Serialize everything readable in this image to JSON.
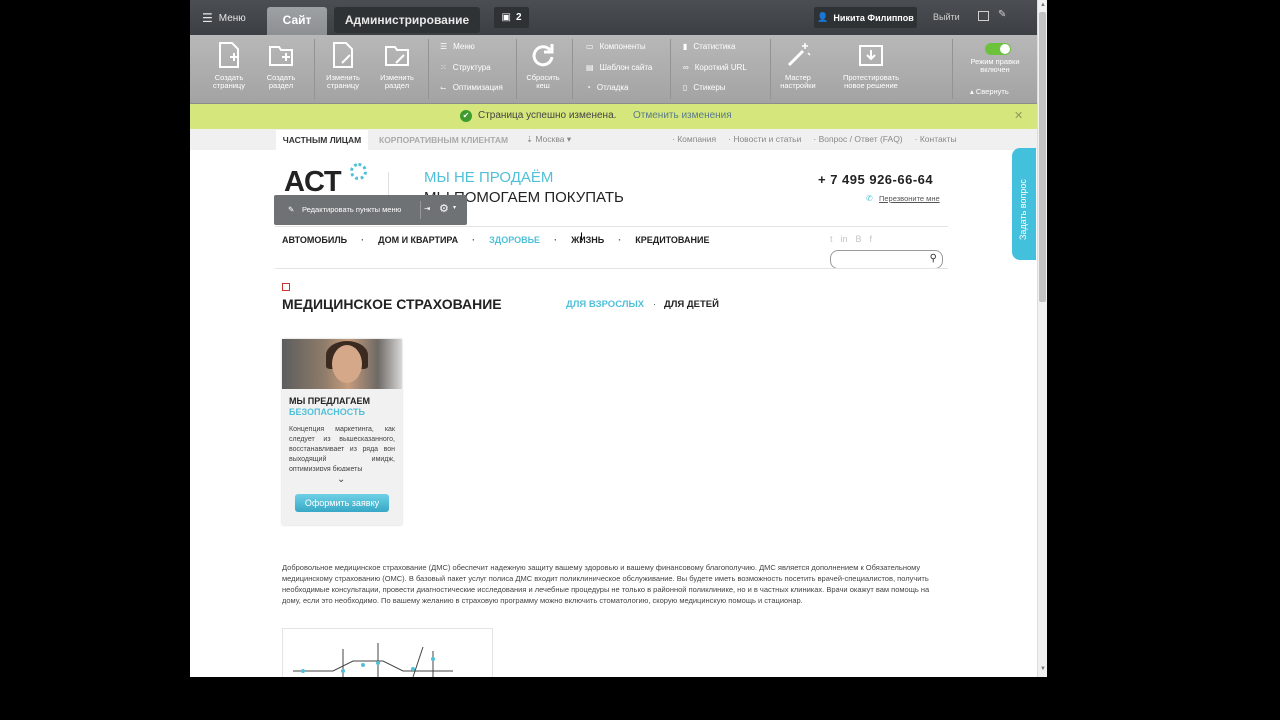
{
  "admin": {
    "menu_label": "Меню",
    "tab_site": "Сайт",
    "tab_admin": "Администрирование",
    "notifications_count": "2",
    "user_name": "Никита Филиппов",
    "logout": "Выйти"
  },
  "toolbar": {
    "create_page": "Создать\nстраницу",
    "create_section": "Создать\nраздел",
    "edit_page": "Изменить\nстраницу",
    "edit_section": "Изменить\nраздел",
    "menu": "Меню",
    "structure": "Структура",
    "optimization": "Оптимизация",
    "reset_cache": "Сбросить\nкеш",
    "components": "Компоненты",
    "site_template": "Шаблон сайта",
    "debug": "Отладка",
    "statistics": "Статистика",
    "short_url": "Короткий URL",
    "stickers": "Стикеры",
    "wizard": "Мастер\nнастройки",
    "test_solution": "Протестировать\nновое решение",
    "edit_mode": "Режим правки\nвключен",
    "collapse": "Свернуть"
  },
  "notice": {
    "message": "Страница успешно изменена.",
    "undo": "Отменить изменения"
  },
  "subnav": {
    "private": "ЧАСТНЫМ ЛИЦАМ",
    "corporate": "КОРПОРАТИВНЫМ КЛИЕНТАМ",
    "city": "Москва",
    "links": [
      "Компания",
      "Новости и статьи",
      "Вопрос / Ответ (FAQ)",
      "Контакты"
    ]
  },
  "header": {
    "logo": "ACT",
    "slogan1": "МЫ НЕ ПРОДАЁМ",
    "slogan2": "МЫ ПОМОГАЕМ ПОКУПАТЬ",
    "phone": "+ 7 495 926-66-64",
    "callback": "Перезвоните мне",
    "edit_menu_items": "Редактировать пункты меню"
  },
  "mainnav": {
    "items": [
      "АВТОМОБИЛЬ",
      "ДОМ И КВАРТИРА",
      "ЗДОРОВЬЕ",
      "ЖИЗНЬ",
      "КРЕДИТОВАНИЕ"
    ],
    "active_index": 2
  },
  "content": {
    "title": "МЕДИЦИНСКОЕ СТРАХОВАНИЕ",
    "for_adults": "ДЛЯ ВЗРОСЛЫХ",
    "for_kids": "ДЛЯ ДЕТЕЙ",
    "card": {
      "title1": "МЫ ПРЕДЛАГАЕМ",
      "title2": "БЕЗОПАСНОСТЬ",
      "text": "Концепция маркетинга, как следует из вышесказанного, восстанавливает из ряда вон выходящий имидж, оптимизируя бюджеты",
      "button": "Оформить заявку"
    },
    "paragraph": "Добровольное медицинское страхование (ДМС) обеспечит надежную защиту вашему здоровью и вашему финансовому благополучию. ДМС является дополнением к Обязательному медицинскому страхованию (ОМС). В базовый пакет услуг полиса ДМС входит поликлиническое обслуживание. Вы будете иметь возможность посетить врачей-специалистов, получить необходимые консультации, провести диагностические исследования и лечебные процедуры не только в районной поликлинике, но и в частных клиниках. Врачи окажут вам помощь на дому, если это необходимо. По вашему желанию в страховую программу можно включить стоматологию, скорую медицинскую помощь и стационар."
  },
  "ask_question": "Задать вопрос"
}
